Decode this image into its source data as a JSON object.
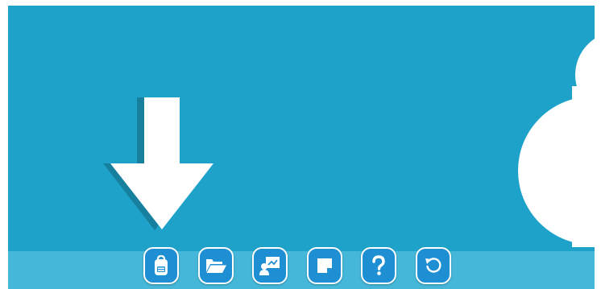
{
  "colors": {
    "stage": "#1ea2c9",
    "strip": "#45b7d8",
    "button": "#1f8fd3",
    "arrow_shadow": "#17809f",
    "white": "#ffffff"
  },
  "toolbar": {
    "buttons": [
      {
        "id": "backpack",
        "icon": "backpack-icon"
      },
      {
        "id": "open-folder",
        "icon": "folder-open-icon"
      },
      {
        "id": "presentation",
        "icon": "presenter-board-icon"
      },
      {
        "id": "note",
        "icon": "sticky-note-icon"
      },
      {
        "id": "help",
        "icon": "help-icon"
      },
      {
        "id": "undo",
        "icon": "undo-icon"
      }
    ]
  }
}
